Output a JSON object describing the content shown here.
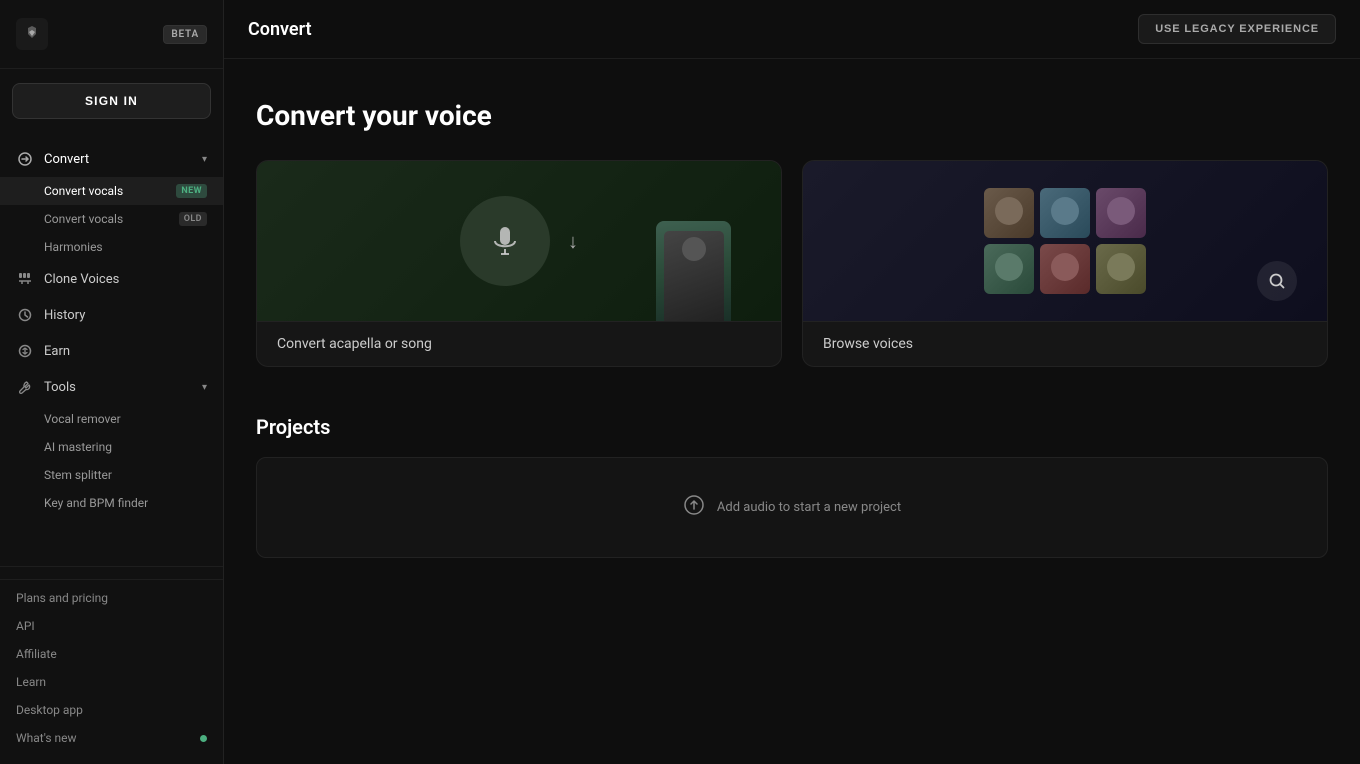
{
  "app": {
    "logo_text": "K",
    "beta_label": "BETA",
    "sign_in_label": "SIGN IN"
  },
  "sidebar": {
    "nav_items": [
      {
        "id": "convert",
        "label": "Convert",
        "icon": "convert-icon",
        "expanded": true,
        "sub_items": [
          {
            "id": "convert-vocals-new",
            "label": "Convert vocals",
            "badge": "NEW",
            "active": true
          },
          {
            "id": "convert-vocals-old",
            "label": "Convert vocals",
            "badge": "OLD"
          },
          {
            "id": "harmonies",
            "label": "Harmonies",
            "badge": ""
          }
        ]
      },
      {
        "id": "clone-voices",
        "label": "Clone Voices",
        "icon": "clone-icon",
        "expanded": false
      },
      {
        "id": "history",
        "label": "History",
        "icon": "history-icon",
        "expanded": false
      },
      {
        "id": "earn",
        "label": "Earn",
        "icon": "earn-icon",
        "expanded": false
      },
      {
        "id": "tools",
        "label": "Tools",
        "icon": "tools-icon",
        "expanded": true,
        "sub_items": [
          {
            "id": "vocal-remover",
            "label": "Vocal remover",
            "badge": ""
          },
          {
            "id": "ai-mastering",
            "label": "AI mastering",
            "badge": ""
          },
          {
            "id": "stem-splitter",
            "label": "Stem splitter",
            "badge": ""
          },
          {
            "id": "key-bpm",
            "label": "Key and BPM finder",
            "badge": ""
          }
        ]
      }
    ],
    "footer_links": [
      {
        "id": "plans",
        "label": "Plans and pricing"
      },
      {
        "id": "api",
        "label": "API"
      },
      {
        "id": "affiliate",
        "label": "Affiliate"
      },
      {
        "id": "learn",
        "label": "Learn"
      },
      {
        "id": "desktop-app",
        "label": "Desktop app"
      },
      {
        "id": "whats-new",
        "label": "What's new",
        "has_dot": true
      }
    ]
  },
  "header": {
    "page_title": "Convert",
    "legacy_btn_label": "USE LEGACY EXPERIENCE"
  },
  "main": {
    "hero_title": "Convert your voice",
    "cards": [
      {
        "id": "convert-acapella",
        "label": "Convert acapella or song"
      },
      {
        "id": "browse-voices",
        "label": "Browse voices"
      }
    ],
    "projects_title": "Projects",
    "add_project_label": "Add audio to start a new project"
  }
}
